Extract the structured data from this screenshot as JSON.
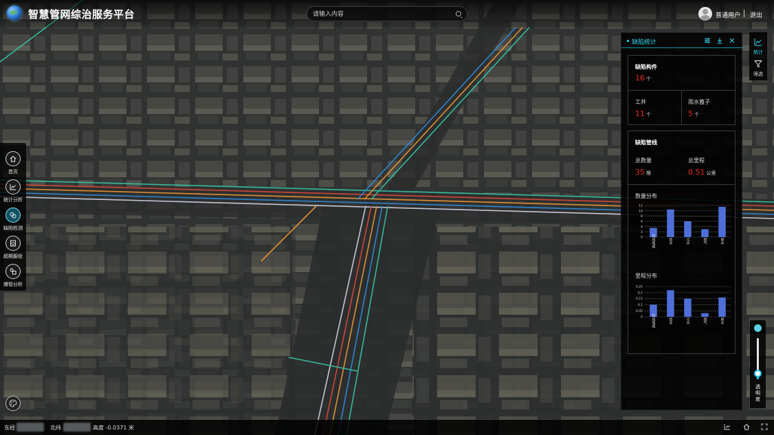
{
  "app": {
    "title": "智慧管网综治服务平台"
  },
  "search": {
    "placeholder": "请输入内容"
  },
  "user": {
    "name": "普通用户",
    "logout_label": "退出"
  },
  "left_nav": {
    "items": [
      {
        "label": "首页",
        "icon": "home-icon"
      },
      {
        "label": "统计分析",
        "icon": "chart-icon"
      },
      {
        "label": "缺陷检测",
        "icon": "defect-icon"
      },
      {
        "label": "超期服役",
        "icon": "overdue-icon"
      },
      {
        "label": "爆管分析",
        "icon": "burst-icon"
      }
    ],
    "active_index": 2
  },
  "right_toolbar": {
    "items": [
      {
        "label": "统计",
        "icon": "bar-chart-icon"
      },
      {
        "label": "筛选",
        "icon": "filter-icon"
      }
    ]
  },
  "transparency_slider": {
    "label": "透明度",
    "value": 0.15
  },
  "panel": {
    "title": "缺陷统计",
    "header_icons": [
      "settings-icon",
      "download-icon",
      "close-icon"
    ],
    "defect_components": {
      "title": "缺陷构件",
      "total_value": "16",
      "total_unit": "个",
      "items": [
        {
          "label": "工井",
          "value": "11",
          "unit": "个"
        },
        {
          "label": "雨水篦子",
          "value": "5",
          "unit": "个"
        }
      ]
    },
    "defect_pipes": {
      "title": "缺陷管线",
      "count_label": "总数量",
      "count_value": "35",
      "count_unit": "根",
      "length_label": "总里程",
      "length_value": "0.51",
      "length_unit": "公里"
    },
    "count_distribution_title": "数量分布",
    "length_distribution_title": "里程分布"
  },
  "status_bar": {
    "lon_label": "东经",
    "lat_label": "北纬",
    "height_text": "高度 -0.0371 米",
    "icons": [
      "chart-icon",
      "home-icon",
      "fullscreen-icon"
    ]
  },
  "chart_data": [
    {
      "type": "bar",
      "title": "数量分布",
      "categories": [
        "有线电视",
        "给水",
        "污水",
        "燃气",
        "雨水"
      ],
      "values": [
        3.5,
        10.5,
        6,
        3,
        11.5
      ],
      "ylim": [
        0,
        12
      ],
      "yticks": [
        0,
        2,
        4,
        6,
        8,
        10,
        12
      ],
      "color": "#4f6fd8"
    },
    {
      "type": "bar",
      "title": "里程分布",
      "categories": [
        "有线电视",
        "给水",
        "污水",
        "燃气",
        "雨水"
      ],
      "values": [
        0.1,
        0.22,
        0.15,
        0.03,
        0.16
      ],
      "ylim": [
        0,
        0.25
      ],
      "yticks": [
        0,
        0.05,
        0.1,
        0.15,
        0.2,
        0.25
      ],
      "color": "#4f6fd8"
    }
  ]
}
